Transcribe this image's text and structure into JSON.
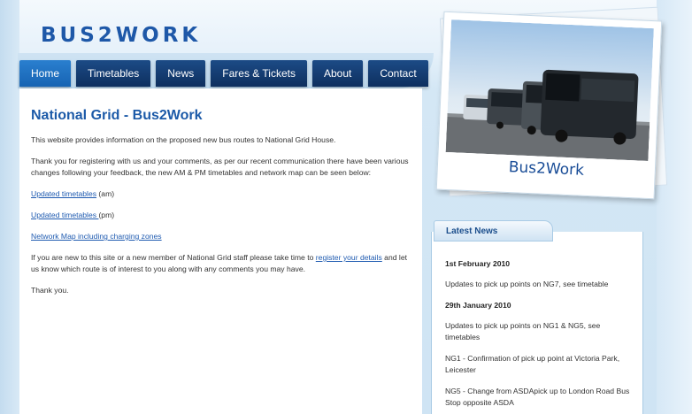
{
  "header": {
    "logo_text_a": "BUS",
    "logo_text_b": "2",
    "logo_text_c": "WORK"
  },
  "nav": {
    "items": [
      {
        "label": "Home",
        "active": true
      },
      {
        "label": "Timetables"
      },
      {
        "label": "News"
      },
      {
        "label": "Fares & Tickets"
      },
      {
        "label": "About"
      },
      {
        "label": "Contact"
      }
    ]
  },
  "main": {
    "title": "National Grid - Bus2Work",
    "intro": "This website provides information on the proposed new bus routes to National Grid House.",
    "thanks": "Thank you for registering with us and your comments, as per our recent communication there have been various changes following your feedback, the new AM & PM timetables and network map can be seen below:",
    "link_am": "Updated timetables",
    "am_suffix": " (am)",
    "link_pm": "Updated timetables ",
    "pm_suffix": "(pm)",
    "link_map": "Network Map including charging zones",
    "new_prefix": "If you are new to this site or a new member of National Grid staff please take time to ",
    "new_link": "register your details",
    "new_suffix": " and let us know which route is of interest to you along with any comments you may have.",
    "thank_you": "Thank you."
  },
  "promo": {
    "caption": "Bus2Work"
  },
  "news": {
    "heading": "Latest News",
    "entries": [
      {
        "date": "1st February 2010",
        "items": [
          "Updates to pick up points on NG7, see timetable"
        ]
      },
      {
        "date": "29th January 2010",
        "items": [
          "Updates to pick up points on NG1 & NG5, see timetables",
          "NG1 - Confirmation of pick up point at Victoria Park, Leicester",
          "NG5 - Change from ASDApick up to London Road Bus Stop opposite ASDA"
        ]
      }
    ]
  },
  "colors": {
    "accent": "#1c5aa8",
    "nav_dark": "#0e2f5f",
    "nav_active": "#1764b3"
  }
}
